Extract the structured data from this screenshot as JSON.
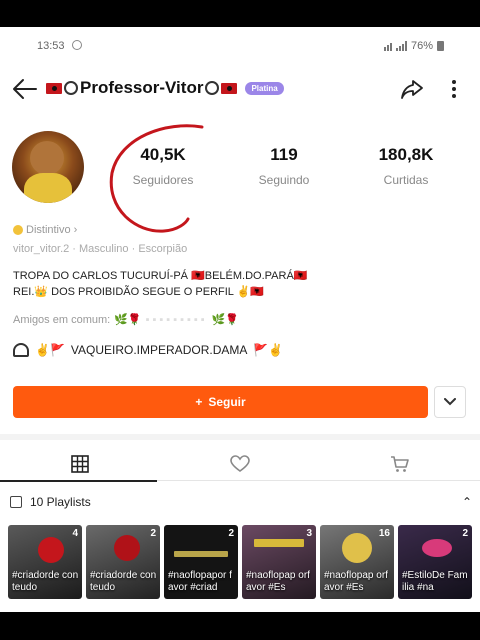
{
  "status": {
    "time": "13:53",
    "battery": "76%"
  },
  "header": {
    "title": "Professor-Vitor",
    "badge": "Platina"
  },
  "stats": [
    {
      "value": "40,5K",
      "label": "Seguidores"
    },
    {
      "value": "119",
      "label": "Seguindo"
    },
    {
      "value": "180,8K",
      "label": "Curtidas"
    }
  ],
  "profile": {
    "distintivo": "Distintivo",
    "meta": "vitor_vitor.2 · Masculino · Escorpião",
    "bio_line1": "TROPA DO CARLOS TUCURUÍ-PÁ 🇦🇱BELÉM.DO.PARÁ🇦🇱",
    "bio_line2": "REI.👑 DOS PROIBIDÃO SEGUE O PERFIL ✌️🇦🇱",
    "amigos": "Amigos em comum:",
    "link": "VAQUEIRO.IMPERADOR.DAMA"
  },
  "actions": {
    "follow": "Seguir"
  },
  "playlists": {
    "header": "10 Playlists",
    "items": [
      {
        "count": "4",
        "caption": "#criadorde conteudo"
      },
      {
        "count": "2",
        "caption": "#criadorde conteudo"
      },
      {
        "count": "2",
        "caption": "#naoflopapor favor #criad"
      },
      {
        "count": "3",
        "caption": "#naoflopap orfavor #Es"
      },
      {
        "count": "16",
        "caption": "#naoflopap orfavor #Es"
      },
      {
        "count": "2",
        "caption": "#EstiloDe Familia #na"
      }
    ]
  },
  "colors": {
    "accent": "#ff5a0e",
    "badge": "#9b86e8",
    "mark": "#c4161c"
  }
}
